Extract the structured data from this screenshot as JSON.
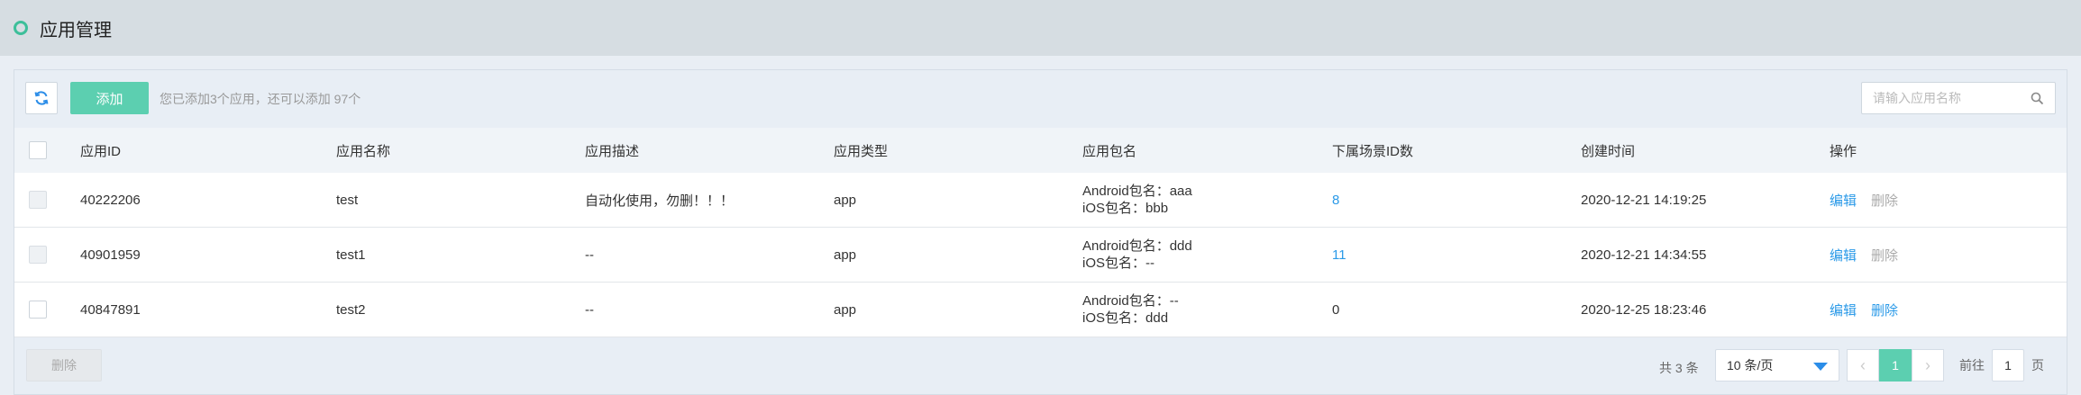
{
  "page": {
    "title": "应用管理"
  },
  "toolbar": {
    "add_label": "添加",
    "hint": "您已添加3个应用，还可以添加 97个",
    "search_placeholder": "请输入应用名称"
  },
  "table": {
    "headers": [
      "应用ID",
      "应用名称",
      "应用描述",
      "应用类型",
      "应用包名",
      "下属场景ID数",
      "创建时间",
      "操作"
    ],
    "rows": [
      {
        "id": "40222206",
        "name": "test",
        "desc": "自动化使用，勿删！！！",
        "type": "app",
        "pkg_android": "Android包名：aaa",
        "pkg_ios": "iOS包名：bbb",
        "count": "8",
        "created": "2020-12-21 14:19:25",
        "edit": "编辑",
        "delete": "删除"
      },
      {
        "id": "40901959",
        "name": "test1",
        "desc": "--",
        "type": "app",
        "pkg_android": "Android包名：ddd",
        "pkg_ios": "iOS包名：--",
        "count": "11",
        "created": "2020-12-21 14:34:55",
        "edit": "编辑",
        "delete": "删除"
      },
      {
        "id": "40847891",
        "name": "test2",
        "desc": "--",
        "type": "app",
        "pkg_android": "Android包名：--",
        "pkg_ios": "iOS包名：ddd",
        "count": "0",
        "created": "2020-12-25 18:23:46",
        "edit": "编辑",
        "delete": "删除"
      }
    ]
  },
  "footer": {
    "delete_label": "删除",
    "total": "共 3 条",
    "page_size": "10 条/页",
    "prev_icon": "‹",
    "next_icon": "›",
    "current_page": "1",
    "goto_prefix": "前往",
    "goto_value": "1",
    "goto_suffix": "页"
  },
  "colors": {
    "accent": "#5ccfb0",
    "link": "#2b9ae8",
    "topbar": "#d6dde2"
  }
}
